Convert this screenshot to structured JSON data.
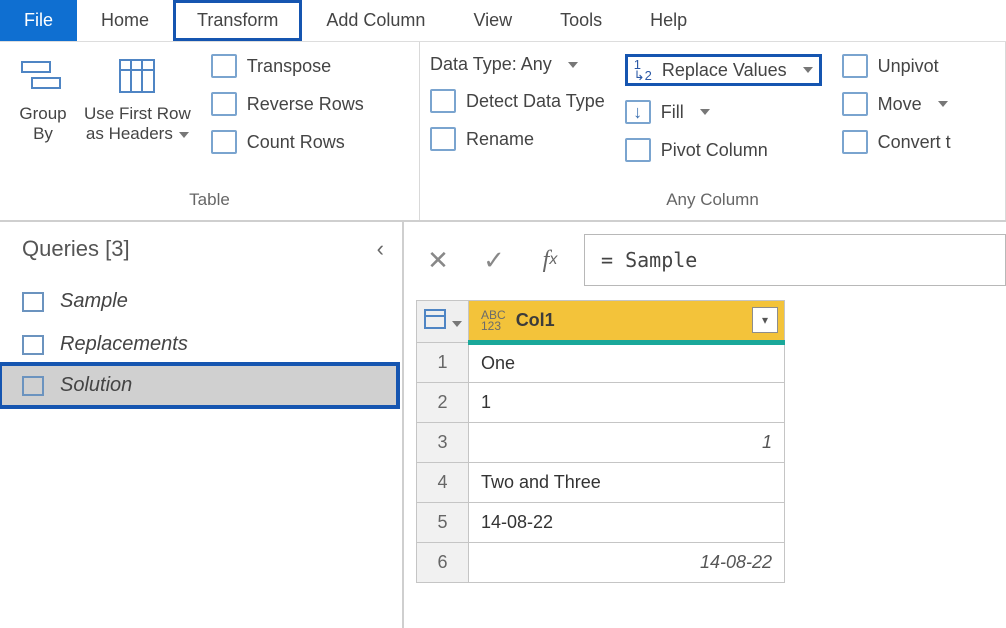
{
  "menu": {
    "file": "File",
    "home": "Home",
    "transform": "Transform",
    "addColumn": "Add Column",
    "view": "View",
    "tools": "Tools",
    "help": "Help"
  },
  "ribbon": {
    "groupBy": "Group\nBy",
    "useFirstRow": "Use First Row\nas Headers",
    "transpose": "Transpose",
    "reverseRows": "Reverse Rows",
    "countRows": "Count Rows",
    "tableGroup": "Table",
    "dataType": "Data Type: Any",
    "detect": "Detect Data Type",
    "rename": "Rename",
    "replaceValues": "Replace Values",
    "fill": "Fill",
    "pivot": "Pivot Column",
    "unpivot": "Unpivot",
    "move": "Move",
    "convert": "Convert t",
    "anyColumnGroup": "Any Column"
  },
  "queries": {
    "title": "Queries [3]",
    "items": [
      "Sample",
      "Replacements",
      "Solution"
    ],
    "selectedIndex": 2
  },
  "formula": "= Sample",
  "table": {
    "col1Header": "Col1",
    "rows": [
      {
        "n": "1",
        "v": "One",
        "italic": false
      },
      {
        "n": "2",
        "v": "1",
        "italic": false
      },
      {
        "n": "3",
        "v": "1",
        "italic": true
      },
      {
        "n": "4",
        "v": "Two and Three",
        "italic": false
      },
      {
        "n": "5",
        "v": "14-08-22",
        "italic": false
      },
      {
        "n": "6",
        "v": "14-08-22",
        "italic": true
      }
    ]
  }
}
